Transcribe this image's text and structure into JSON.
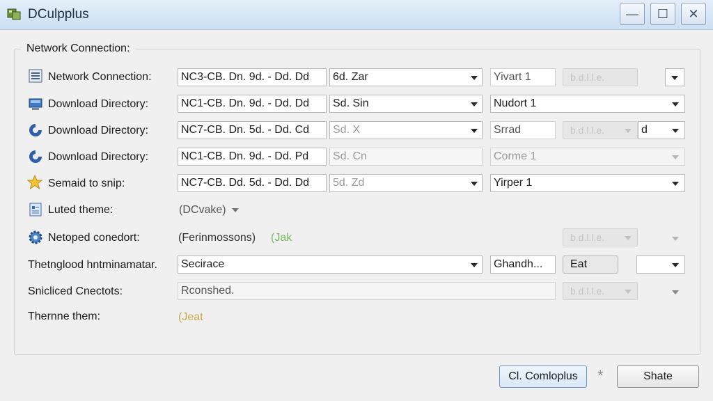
{
  "window": {
    "title": "DCulpplus",
    "minimize_glyph": "—",
    "maximize_glyph": "☐",
    "close_glyph": "✕"
  },
  "group_title": "Network Connection:",
  "rows": [
    {
      "label": "Network Connection:",
      "icon": "network-list-icon",
      "field1": "NC3-CB. Dn. 9d. -  Dd. Dd",
      "field2": "6d. Zar",
      "field3": "Yivart 1"
    },
    {
      "label": "Download Directory:",
      "icon": "monitor-icon",
      "field1": "NC1-CB. Dn. 9d. -  Dd. Dd",
      "field2": "Sd. Sin",
      "field3": "Nudort 1"
    },
    {
      "label": "Download Directory:",
      "icon": "blue-circle-icon",
      "field1": "NC7-CB. Dn. 5d. -  Dd. Cd",
      "field2": "Sd. X",
      "field3": "Srrad",
      "field4": "d"
    },
    {
      "label": "Download Directory:",
      "icon": "blue-circle-icon",
      "field1": "NC1-CB. Dn. 9d. -  Dd. Pd",
      "field2": "Sd. Cn",
      "field3": "Corme 1"
    },
    {
      "label": "Semaid to snip:",
      "icon": "star-icon",
      "field1": "NC7-CB. Dd. 5d. -  Dd. Dd",
      "field2": "5d. Zd",
      "field3": "Yirper 1"
    },
    {
      "label": "Luted theme:",
      "icon": "document-icon",
      "dropdown": "(DCvake)"
    },
    {
      "label": "Netoped conedort:",
      "icon": "gear-icon",
      "value": "(Ferinmossons)",
      "extra": "(Jak"
    },
    {
      "label": "Thetnglood hntminamatar.",
      "combo": "Secirace",
      "field3": "Ghandh...",
      "button": "Eat"
    },
    {
      "label": "Snicliced Cnectots:",
      "value": "Rconshed."
    },
    {
      "label": "Thernne them:",
      "value": "(Jeat"
    }
  ],
  "disabled_button_text": "b.d.l.l.e.",
  "footer": {
    "primary_button": "Cl. Comloplus",
    "asterisk": "*",
    "secondary_button": "Shate"
  },
  "colors": {
    "titlebar": "#cddff2",
    "accent": "#6b92c4",
    "background": "#f0f0f0"
  }
}
